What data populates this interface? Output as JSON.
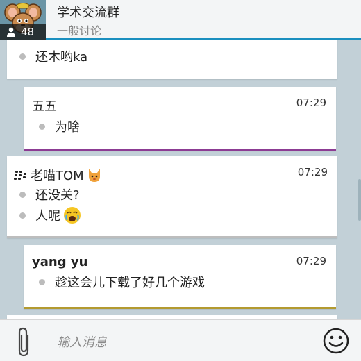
{
  "header": {
    "title": "学术交流群",
    "subtitle": "一般讨论",
    "member_count": "48"
  },
  "messages": [
    {
      "sender": "",
      "time": "",
      "lines": [
        "还木哟ka"
      ],
      "accent": "#ffffff"
    },
    {
      "sender": "五五",
      "time": "07:29",
      "lines": [
        "为啥"
      ],
      "accent": "#8c3b93"
    },
    {
      "sender": "老喵TOM",
      "time": "07:29",
      "lines": [
        "还没关?",
        "人呢"
      ],
      "accent": "#bdbdbd"
    },
    {
      "sender": "yang yu",
      "time": "07:29",
      "lines": [
        "趁这会儿下载了好几个游戏"
      ],
      "accent": "#b39a2f"
    }
  ],
  "composer": {
    "placeholder": "输入消息"
  },
  "colors": {
    "header_accent": "#1a8fbf",
    "background": "#c2d0d7"
  },
  "icons": [
    "member-icon",
    "blackberry-icon",
    "cat-emoji-icon",
    "crying-emoji-icon",
    "paperclip-icon",
    "smiley-icon"
  ]
}
